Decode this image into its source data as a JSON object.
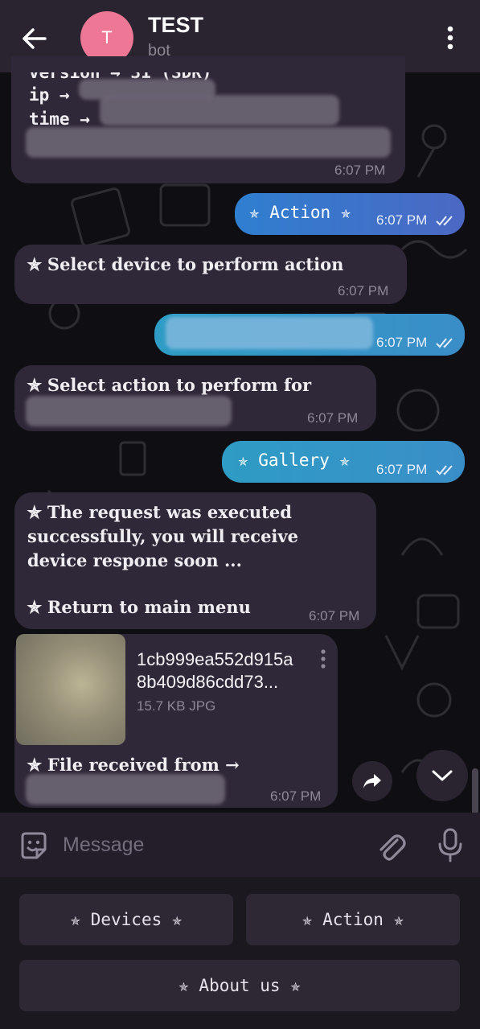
{
  "header": {
    "avatar_letter": "T",
    "title": "TEST",
    "subtitle": "bot"
  },
  "messages": {
    "m1": {
      "line_partial": "version → 31 (SDK)",
      "line_ip": "ip →",
      "line_time": "time →",
      "time": "6:07 PM"
    },
    "m2": {
      "text": "✯ Action ✯",
      "time": "6:07 PM"
    },
    "m3": {
      "text": "✯ Select device to perform action",
      "time": "6:07 PM"
    },
    "m4": {
      "time": "6:07 PM"
    },
    "m5": {
      "text": "✯ Select action to perform for",
      "time": "6:07 PM"
    },
    "m6": {
      "text": "✯ Gallery ✯",
      "time": "6:07 PM"
    },
    "m7": {
      "line1": "✯ The request was executed",
      "line2": "successfully, you will receive",
      "line3": "device respone soon ...",
      "line4": "✯ Return to main menu",
      "time": "6:07 PM"
    },
    "m8": {
      "file_name_1": "1cb999ea552d915a",
      "file_name_2": "8b409d86cdd73...",
      "file_size": "15.7 KB JPG",
      "caption": "✯ File received from →",
      "time": "6:07 PM"
    }
  },
  "input": {
    "placeholder": "Message"
  },
  "keyboard": {
    "devices": "✯ Devices ✯",
    "action": "✯ Action ✯",
    "about": "✯ About us ✯"
  },
  "colors": {
    "header_bg": "#2a2430",
    "incoming_bubble": "#2f2838",
    "outgoing_gradient_start": "#2f7fd0",
    "outgoing_gradient_end": "#4b68c4",
    "avatar": "#ef7796"
  }
}
